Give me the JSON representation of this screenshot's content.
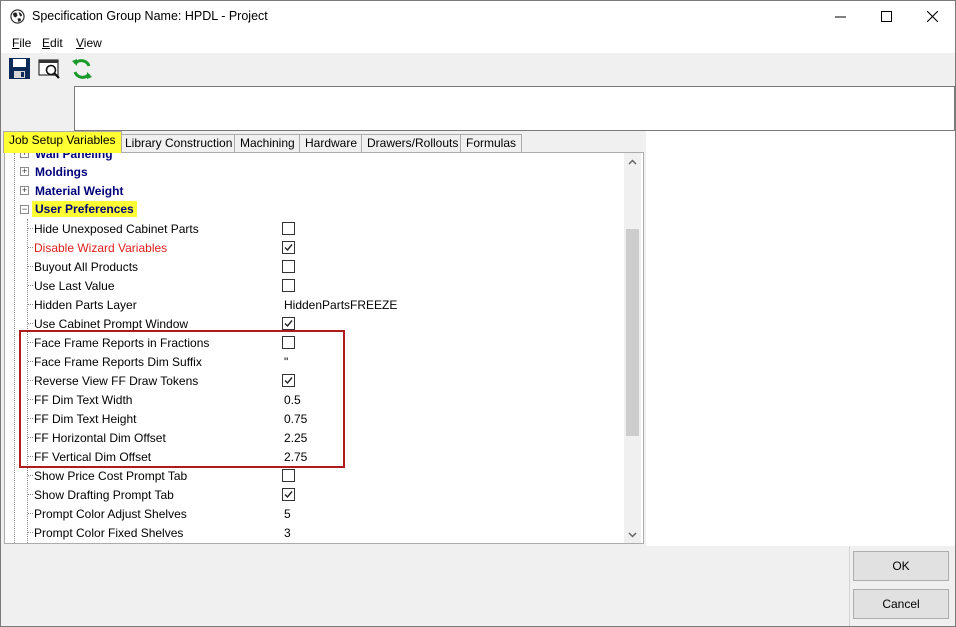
{
  "window": {
    "title": "Specification Group Name: HPDL - Project",
    "icon": "globe-icon"
  },
  "menu": [
    {
      "label": "File",
      "accel": "F"
    },
    {
      "label": "Edit",
      "accel": "E"
    },
    {
      "label": "View",
      "accel": "V"
    }
  ],
  "toolbar": {
    "icons": [
      "save-icon",
      "print-preview-icon",
      "refresh-icon"
    ]
  },
  "tabs": [
    {
      "label": "Job Setup Variables",
      "active": true
    },
    {
      "label": "Library Construction"
    },
    {
      "label": "Machining"
    },
    {
      "label": "Hardware"
    },
    {
      "label": "Drawers/Rollouts"
    },
    {
      "label": "Formulas"
    }
  ],
  "tree": {
    "nodes": [
      {
        "label": "Wall Paneling",
        "collapsed": true
      },
      {
        "label": "Moldings",
        "collapsed": true
      },
      {
        "label": "Material Weight",
        "collapsed": true
      },
      {
        "label": "User Preferences",
        "collapsed": false,
        "highlighted": true
      }
    ],
    "properties": [
      {
        "label": "Hide Unexposed Cabinet Parts",
        "type": "checkbox",
        "checked": false
      },
      {
        "label": "Disable Wizard Variables",
        "type": "checkbox",
        "checked": true,
        "color": "red"
      },
      {
        "label": "Buyout All Products",
        "type": "checkbox",
        "checked": false
      },
      {
        "label": "Use Last Value",
        "type": "checkbox",
        "checked": false
      },
      {
        "label": "Hidden Parts Layer",
        "type": "text",
        "value": "HiddenPartsFREEZE"
      },
      {
        "label": "Use Cabinet Prompt Window",
        "type": "checkbox",
        "checked": true
      },
      {
        "label": "Face Frame Reports in Fractions",
        "type": "checkbox",
        "checked": false
      },
      {
        "label": "Face Frame Reports Dim Suffix",
        "type": "text",
        "value": "\""
      },
      {
        "label": "Reverse View FF Draw Tokens",
        "type": "checkbox",
        "checked": true
      },
      {
        "label": "FF Dim Text Width",
        "type": "text",
        "value": "0.5"
      },
      {
        "label": "FF Dim Text Height",
        "type": "text",
        "value": "0.75"
      },
      {
        "label": "FF Horizontal Dim Offset",
        "type": "text",
        "value": "2.25"
      },
      {
        "label": "FF Vertical Dim Offset",
        "type": "text",
        "value": "2.75"
      },
      {
        "label": "Show Price Cost Prompt Tab",
        "type": "checkbox",
        "checked": false
      },
      {
        "label": "Show Drafting Prompt Tab",
        "type": "checkbox",
        "checked": true
      },
      {
        "label": "Prompt Color Adjust Shelves",
        "type": "text",
        "value": "5"
      },
      {
        "label": "Prompt Color Fixed Shelves",
        "type": "text",
        "value": "3"
      }
    ]
  },
  "buttons": {
    "ok": "OK",
    "cancel": "Cancel"
  },
  "colors": {
    "highlight": "#ffff33",
    "annotation_box": "#b01a1a",
    "node_text": "#00007a",
    "warning_text": "#e0201e"
  }
}
